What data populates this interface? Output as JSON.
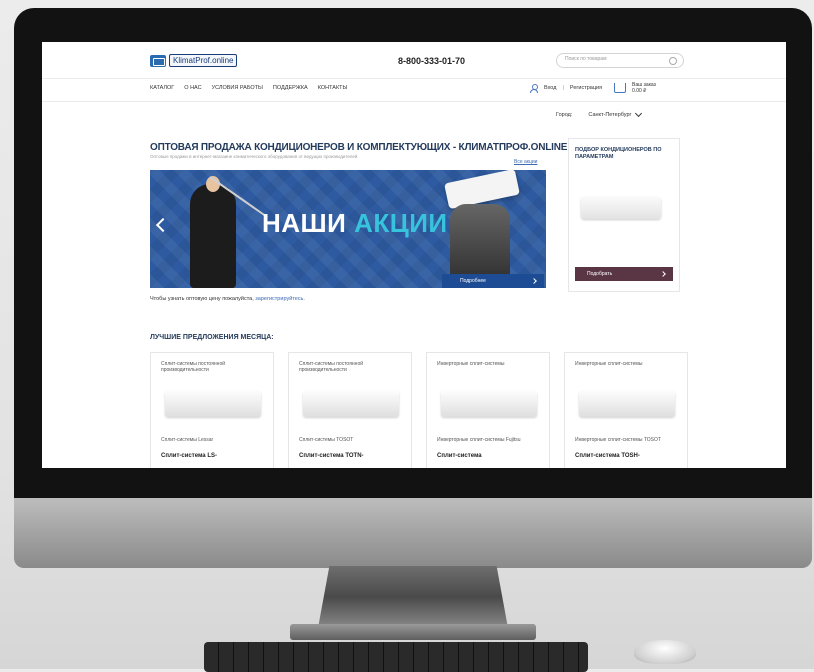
{
  "header": {
    "logo_text": "KlimatProf.online",
    "phone": "8-800-333-01-70",
    "search_placeholder": "Поиск по товарам"
  },
  "nav": {
    "items": [
      "КАТАЛОГ",
      "О НАС",
      "УСЛОВИЯ РАБОТЫ",
      "ПОДДЕРЖКА",
      "КОНТАКТЫ"
    ],
    "login": "Вход",
    "register": "Регистрация",
    "cart_line1": "Ваш заказ",
    "cart_line2": "0.00 ₽"
  },
  "city": {
    "label": "Город:",
    "value": "Санкт-Петербург"
  },
  "main": {
    "title": "ОПТОВАЯ ПРОДАЖА КОНДИЦИОНЕРОВ И КОМПЛЕКТУЮЩИХ - КЛИМАТПРОФ.ONLINE",
    "subtitle": "Оптовые продажи в интернет-магазине климатического оборудования от ведущих производителей",
    "all_link": "Все акции"
  },
  "banner": {
    "title_white": "НАШИ",
    "title_accent": "АКЦИИ",
    "button": "Подробнее"
  },
  "note": {
    "text": "Чтобы узнать оптовую цену пожалуйста,",
    "link": "зарегистрируйтесь."
  },
  "side": {
    "title": "ПОДБОР КОНДИЦИОНЕРОВ ПО ПАРАМЕТРАМ",
    "button": "Подобрать"
  },
  "offers": {
    "title": "ЛУЧШИЕ ПРЕДЛОЖЕНИЯ МЕСЯЦА:",
    "cards": [
      {
        "category": "Сплит-системы постоянной производительности",
        "brand": "Сплит-системы Lessar",
        "name": "Сплит-система LS-"
      },
      {
        "category": "Сплит-системы постоянной производительности",
        "brand": "Сплит-системы TOSOT",
        "name": "Сплит-система TOTN-"
      },
      {
        "category": "Инверторные сплит-системы",
        "brand": "Инверторные сплит-системы Fujitsu",
        "name": "Сплит-система"
      },
      {
        "category": "Инверторные сплит-системы",
        "brand": "Инверторные сплит-системы TOSOT",
        "name": "Сплит-система TOSH-"
      }
    ]
  }
}
